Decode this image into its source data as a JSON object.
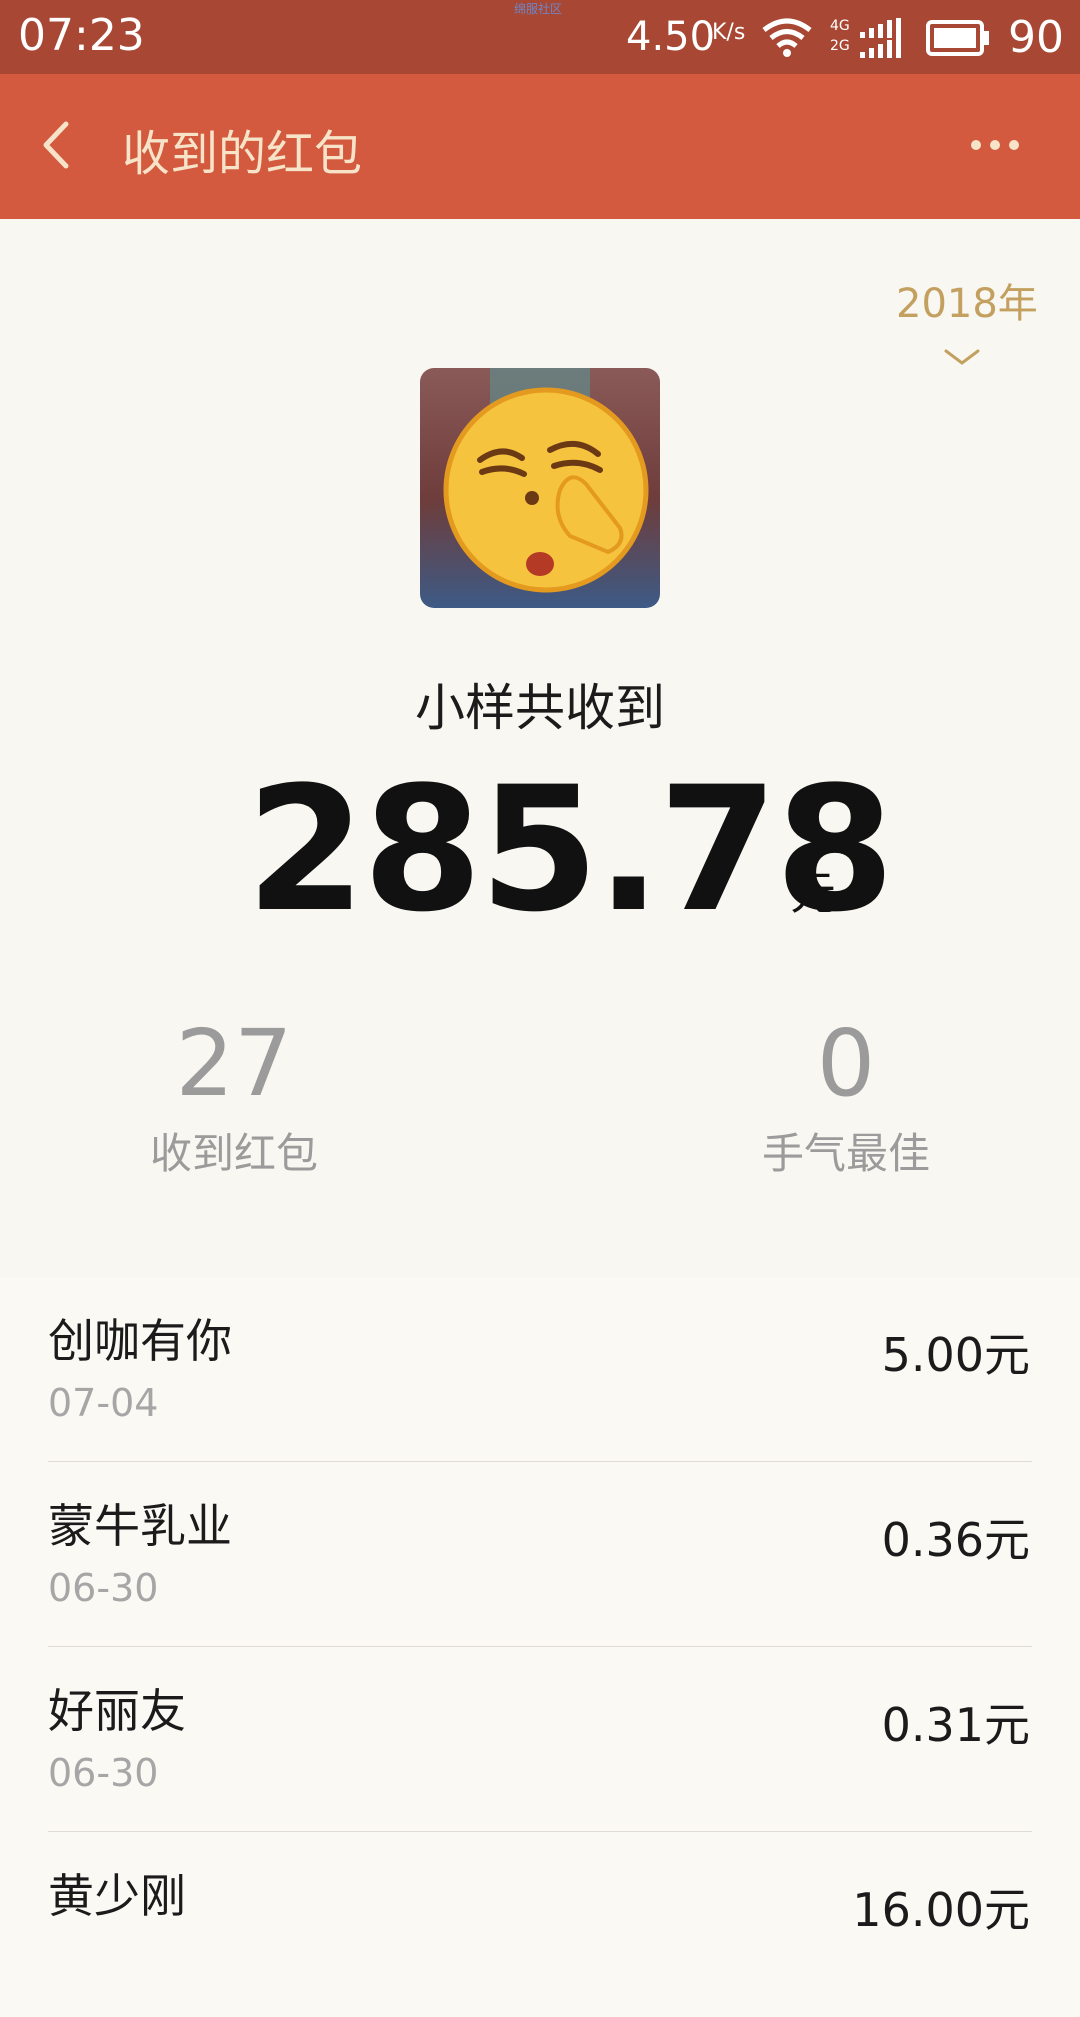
{
  "status_bar": {
    "time": "07:23",
    "watermark": "绵服社区",
    "net_speed": "4.50",
    "net_speed_unit": "K/s",
    "network_labels": [
      "4G",
      "2G"
    ],
    "battery": "90"
  },
  "header": {
    "title": "收到的红包",
    "back_icon": "chevron-left-icon",
    "more_icon": "more-dots-icon"
  },
  "summary": {
    "year": "2018年",
    "receiver_label": "小样共收到",
    "total_amount": "285.78",
    "total_unit": "元",
    "stats": [
      {
        "value": "27",
        "label": "收到红包"
      },
      {
        "value": "0",
        "label": "手气最佳"
      }
    ]
  },
  "records": [
    {
      "name": "创咖有你",
      "date": "07-04",
      "amount": "5.00元"
    },
    {
      "name": "蒙牛乳业",
      "date": "06-30",
      "amount": "0.36元"
    },
    {
      "name": "好丽友",
      "date": "06-30",
      "amount": "0.31元"
    },
    {
      "name": "黄少刚",
      "date": "",
      "amount": "16.00元"
    }
  ],
  "colors": {
    "status_bar": "#a84733",
    "header": "#d35a3f",
    "header_text": "#f6e3c8",
    "year_accent": "#c3a060",
    "background": "#f9f7f1"
  }
}
